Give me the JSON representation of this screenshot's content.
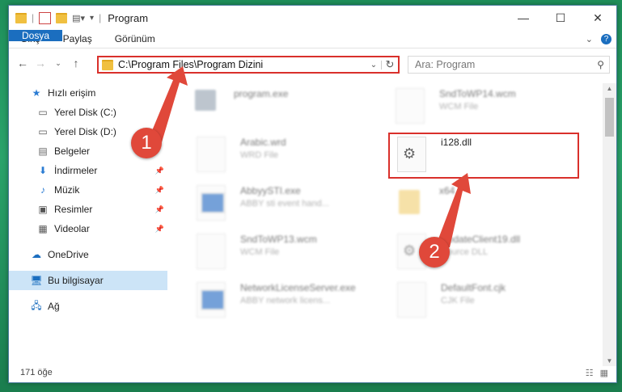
{
  "window": {
    "title": "Program",
    "controls": {
      "minimize": "—",
      "maximize": "☐",
      "close": "✕"
    }
  },
  "ribbon": {
    "tabs": [
      "Dosya",
      "Giriş",
      "Paylaş",
      "Görünüm"
    ]
  },
  "address": {
    "path": "C:\\Program Files\\Program Dizini",
    "search_placeholder": "Ara: Program"
  },
  "sidebar": {
    "items": [
      {
        "label": "Hızlı erişim",
        "icon": "star-icon"
      },
      {
        "label": "Yerel Disk (C:)",
        "icon": "drive-icon"
      },
      {
        "label": "Yerel Disk (D:)",
        "icon": "drive-icon"
      },
      {
        "label": "Belgeler",
        "icon": "documents-icon"
      },
      {
        "label": "İndirmeler",
        "icon": "download-icon"
      },
      {
        "label": "Müzik",
        "icon": "music-icon"
      },
      {
        "label": "Resimler",
        "icon": "pictures-icon"
      },
      {
        "label": "Videolar",
        "icon": "video-icon"
      },
      {
        "label": "OneDrive",
        "icon": "cloud-icon"
      },
      {
        "label": "Bu bilgisayar",
        "icon": "computer-icon"
      },
      {
        "label": "Ağ",
        "icon": "network-icon"
      }
    ]
  },
  "files": [
    {
      "name": "program.exe",
      "sub": ""
    },
    {
      "name": "SndToWP14.wcm",
      "sub": "WCM File"
    },
    {
      "name": "Arabic.wrd",
      "sub": "WRD File"
    },
    {
      "name": "i128.dll",
      "sub": ""
    },
    {
      "name": "AbbyySTI.exe",
      "sub": "ABBY sti event hand..."
    },
    {
      "name": "x64",
      "sub": ""
    },
    {
      "name": "SndToWP13.wcm",
      "sub": "WCM File"
    },
    {
      "name": "UpdateClient19.dll",
      "sub": "Source DLL"
    },
    {
      "name": "NetworkLicenseServer.exe",
      "sub": "ABBY network licens..."
    },
    {
      "name": "DefaultFont.cjk",
      "sub": "CJK File"
    }
  ],
  "status": {
    "count": "171 öğe"
  },
  "annotations": {
    "badge1": "1",
    "badge2": "2"
  },
  "colors": {
    "highlight": "#d9302b",
    "accent": "#1b6ebf"
  }
}
